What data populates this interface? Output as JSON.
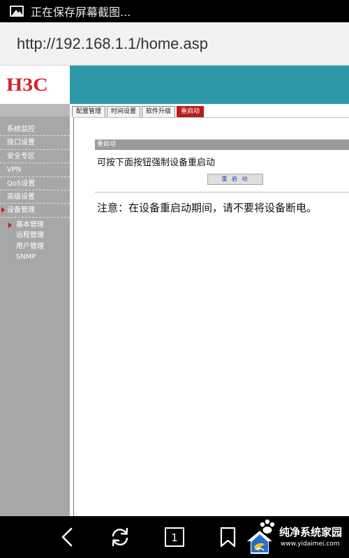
{
  "status_bar": {
    "notification_text": "正在保存屏幕截图..."
  },
  "browser": {
    "url": "http://192.168.1.1/home.asp"
  },
  "router": {
    "logo": "H3C",
    "sidebar": {
      "items": [
        {
          "label": "系统监控"
        },
        {
          "label": "接口设置"
        },
        {
          "label": "安全专区"
        },
        {
          "label": "VPN"
        },
        {
          "label": "QoS设置"
        },
        {
          "label": "高级设置"
        },
        {
          "label": "设备管理"
        }
      ],
      "active_item": "设备管理",
      "subitems": [
        {
          "label": "基本管理"
        },
        {
          "label": "远程管理"
        },
        {
          "label": "用户管理"
        },
        {
          "label": "SNMP"
        }
      ],
      "active_subitem": "基本管理"
    },
    "tabs": [
      {
        "label": "配置管理"
      },
      {
        "label": "时间设置"
      },
      {
        "label": "软件升级"
      },
      {
        "label": "重启动"
      }
    ],
    "active_tab": "重启动",
    "section": {
      "title": "重启动",
      "description": "可按下面按钮强制设备重启动",
      "button_label": "重 启 动",
      "note": "注意：在设备重启动期间，请不要将设备断电。"
    }
  },
  "navbar": {
    "icons": [
      "back-icon",
      "refresh-icon",
      "tabs-icon",
      "bookmark-icon"
    ],
    "tab_count": "1"
  },
  "watermark": {
    "title": "纯净系统家园",
    "url": "www.yidaimei.com"
  },
  "colors": {
    "header_teal": "#2e9aa8",
    "brand_red": "#d2232a",
    "active_tab": "#b71c1c",
    "sidebar_gray": "#a7a7a7"
  }
}
